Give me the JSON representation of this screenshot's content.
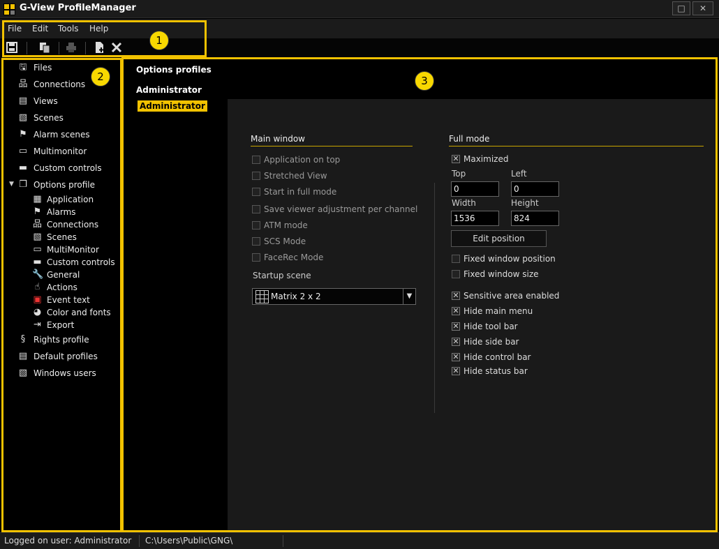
{
  "window": {
    "title": "G-View ProfileManager",
    "maximize_glyph": "□",
    "close_glyph": "✕"
  },
  "menubar": {
    "items": [
      "File",
      "Edit",
      "Tools",
      "Help"
    ]
  },
  "toolbar": {
    "icons": [
      "save-icon",
      "copy-icon",
      "print-icon",
      "new-document-icon",
      "delete-icon"
    ]
  },
  "callouts": [
    "1",
    "2",
    "3"
  ],
  "sidebar": {
    "items": [
      {
        "label": "Files",
        "icon": "file-icon"
      },
      {
        "label": "Connections",
        "icon": "network-icon"
      },
      {
        "label": "Views",
        "icon": "document-icon"
      },
      {
        "label": "Scenes",
        "icon": "scene-icon"
      },
      {
        "label": "Alarm scenes",
        "icon": "flag-icon"
      },
      {
        "label": "Multimonitor",
        "icon": "monitor-icon"
      },
      {
        "label": "Custom controls",
        "icon": "controls-icon"
      },
      {
        "label": "Options profile",
        "icon": "copy-icon"
      },
      {
        "label": "Rights profile",
        "icon": "rights-icon"
      },
      {
        "label": "Default profiles",
        "icon": "document-icon"
      },
      {
        "label": "Windows users",
        "icon": "users-icon"
      }
    ],
    "subitems": [
      {
        "label": "Application",
        "icon": "application-icon"
      },
      {
        "label": "Alarms",
        "icon": "flag-icon"
      },
      {
        "label": "Connections",
        "icon": "network-icon"
      },
      {
        "label": "Scenes",
        "icon": "scene-icon"
      },
      {
        "label": "MultiMonitor",
        "icon": "monitor-icon"
      },
      {
        "label": "Custom controls",
        "icon": "controls-icon"
      },
      {
        "label": "General",
        "icon": "wrench-icon"
      },
      {
        "label": "Actions",
        "icon": "hand-icon"
      },
      {
        "label": "Event text",
        "icon": "event-icon"
      },
      {
        "label": "Color and fonts",
        "icon": "palette-icon"
      },
      {
        "label": "Export",
        "icon": "export-icon"
      }
    ]
  },
  "main": {
    "header": "Options profiles",
    "group": "Administrator",
    "selected_profile": "Administrator"
  },
  "main_window": {
    "title": "Main window",
    "options": [
      {
        "label": "Application on top",
        "checked": false
      },
      {
        "label": "Stretched View",
        "checked": false
      },
      {
        "label": "Start in full mode",
        "checked": false
      },
      {
        "label": "Save viewer adjustment per channel",
        "checked": false
      },
      {
        "label": "ATM mode",
        "checked": false
      },
      {
        "label": "SCS Mode",
        "checked": false
      },
      {
        "label": "FaceRec Mode",
        "checked": false
      }
    ],
    "startup_scene_label": "Startup scene",
    "startup_scene_value": "Matrix 2 x 2"
  },
  "full_mode": {
    "title": "Full mode",
    "maximized": {
      "label": "Maximized",
      "checked": true
    },
    "top_label": "Top",
    "top_value": "0",
    "left_label": "Left",
    "left_value": "0",
    "width_label": "Width",
    "width_value": "1536",
    "height_label": "Height",
    "height_value": "824",
    "edit_position_label": "Edit position",
    "fixed_options": [
      {
        "label": "Fixed window position",
        "checked": false
      },
      {
        "label": "Fixed window size",
        "checked": false
      }
    ],
    "hide_options": [
      {
        "label": "Sensitive area enabled",
        "checked": true
      },
      {
        "label": "Hide main menu",
        "checked": true
      },
      {
        "label": "Hide tool bar",
        "checked": true
      },
      {
        "label": "Hide side bar",
        "checked": true
      },
      {
        "label": "Hide control bar",
        "checked": true
      },
      {
        "label": "Hide status bar",
        "checked": true
      }
    ]
  },
  "statusbar": {
    "user": "Logged on user: Administrator",
    "path": "C:\\Users\\Public\\GNG\\"
  },
  "colors": {
    "accent": "#f2c200",
    "panel": "#1a1a1a",
    "background": "#000000"
  }
}
